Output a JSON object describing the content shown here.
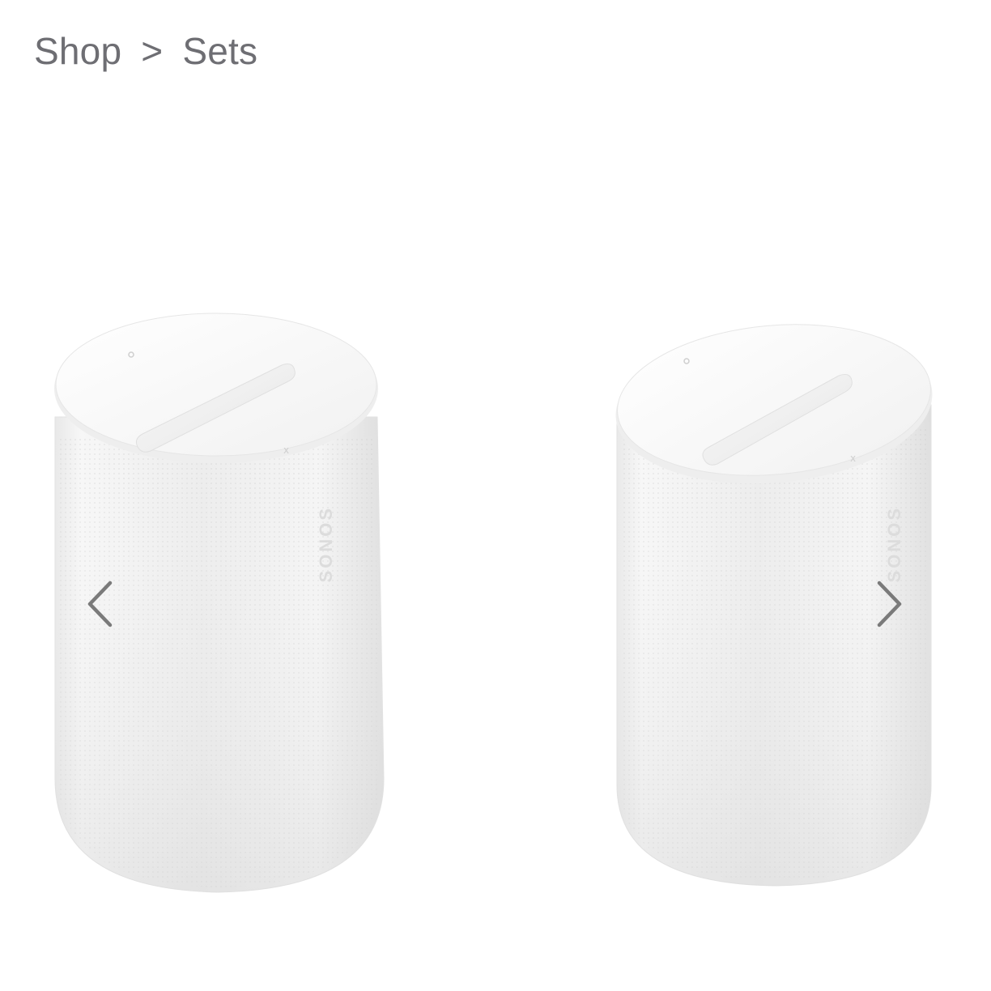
{
  "breadcrumb": {
    "items": [
      "Shop",
      "Sets"
    ],
    "separator": ">"
  },
  "gallery": {
    "brand_text": "SONOS",
    "prev_icon": "chevron-left-icon",
    "next_icon": "chevron-right-icon"
  },
  "colors": {
    "breadcrumb_text": "#6e6e73",
    "arrow": "#7a7a7a",
    "background": "#ffffff"
  }
}
